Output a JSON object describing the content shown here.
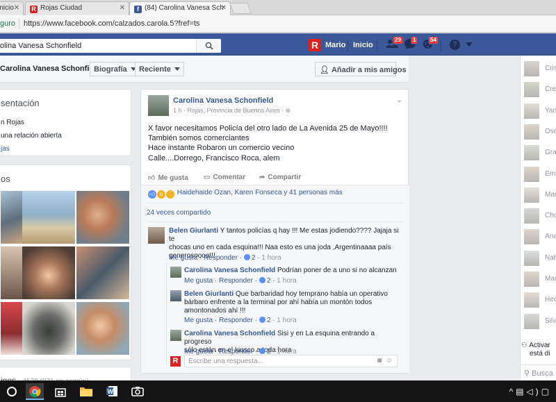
{
  "browser": {
    "tabs": [
      {
        "label": "inicio",
        "favicon": "page-icon"
      },
      {
        "label": "Rojas Ciudad",
        "favicon": "R"
      },
      {
        "label": "(84) Carolina Vanesa Sch",
        "favicon": "f"
      }
    ],
    "address_secure": "guro",
    "address_url": "https://www.facebook.com/calzados.carola.5?fref=ts"
  },
  "fb_header": {
    "search_value": "olina Vanesa Schonfield",
    "user_name": "Mario",
    "home_label": "Inicio",
    "badges": {
      "friends": "29",
      "messages": "1",
      "notifications": "54"
    },
    "accent_color": "#3b5998"
  },
  "profile_nav": {
    "name": "Carolina Vanesa Schonfield",
    "tab_bio": "Biografía",
    "tab_recent": "Reciente",
    "add_friend": "Añadir a mis amigos"
  },
  "intro": {
    "title": "sentación",
    "lines": [
      "n Rojas",
      "una relación abierta",
      "jas"
    ]
  },
  "photos": {
    "title": "os"
  },
  "friends_footer": {
    "label": "igos",
    "count": "· 4520 (971 en común)"
  },
  "post": {
    "author": "Carolina Vanesa Schonfield",
    "meta": "1 h · Rojas, Provincia de Buenos Aires · ",
    "text_lines": [
      "X favor necesitamos Policía del otro lado de La Avenida 25 de Mayo!!!!",
      "También somos comerciantes",
      "Hace instante Robaron un comercio vecino",
      "Calle....Dorrego, Francisco Roca, alem"
    ],
    "like_label": "Me gusta",
    "comment_label": "Comentar",
    "share_label": "Compartir",
    "reactions_text": "Haidehaide Ozan, Karen Fonseca y 41 personas más",
    "shares_text": "24 veces compartido"
  },
  "comments": [
    {
      "author": "Belen Giurlanti",
      "text_lines": [
        "Y tantos policías q hay !!! Me estas jodiendo???? Jajaja si te",
        "chocas uno en cada esquina!!! Naa esto es una joda ,Argentinaaaa país",
        "generosoooo!!!"
      ],
      "like": "Me gusta",
      "reply": "Responder",
      "likes": "2",
      "time": "1 hora"
    },
    {
      "author": "Carolina Vanesa Schonfield",
      "text_lines": [
        "Podrían poner de a uno si no alcanzan"
      ],
      "like": "Me gusta",
      "reply": "Responder",
      "likes": "2",
      "time": "1 hora"
    },
    {
      "author": "Belen Giurlanti",
      "text_lines": [
        "Que barbaridad hoy temprano había un operativo",
        "bárbaro enfrente a la terminal por ahí había un montón todos",
        "amontonados ahí !!!"
      ],
      "like": "Me gusta",
      "reply": "Responder",
      "likes": "2",
      "time": "1 hora"
    },
    {
      "author": "Carolina Vanesa Schonfield",
      "text_lines": [
        "Sisi y en La esquina entrando a progreso",
        "sólo están en el kiosco a toda hora"
      ],
      "like": "Me gusta",
      "reply": "Responder",
      "likes": "2",
      "time": "1 hora"
    }
  ],
  "reply_placeholder": "Escribe una respuesta...",
  "chat_sidebar": {
    "contacts": [
      "Cris",
      "Cres",
      "Yan",
      "Osc",
      "Gra",
      "Emi",
      "Mar",
      "Cho",
      "Ana",
      "Nah",
      "Mar",
      "Hec",
      "Silv"
    ],
    "activate_line1": "Activar",
    "activate_line2": "está di",
    "search_label": "Busca"
  }
}
